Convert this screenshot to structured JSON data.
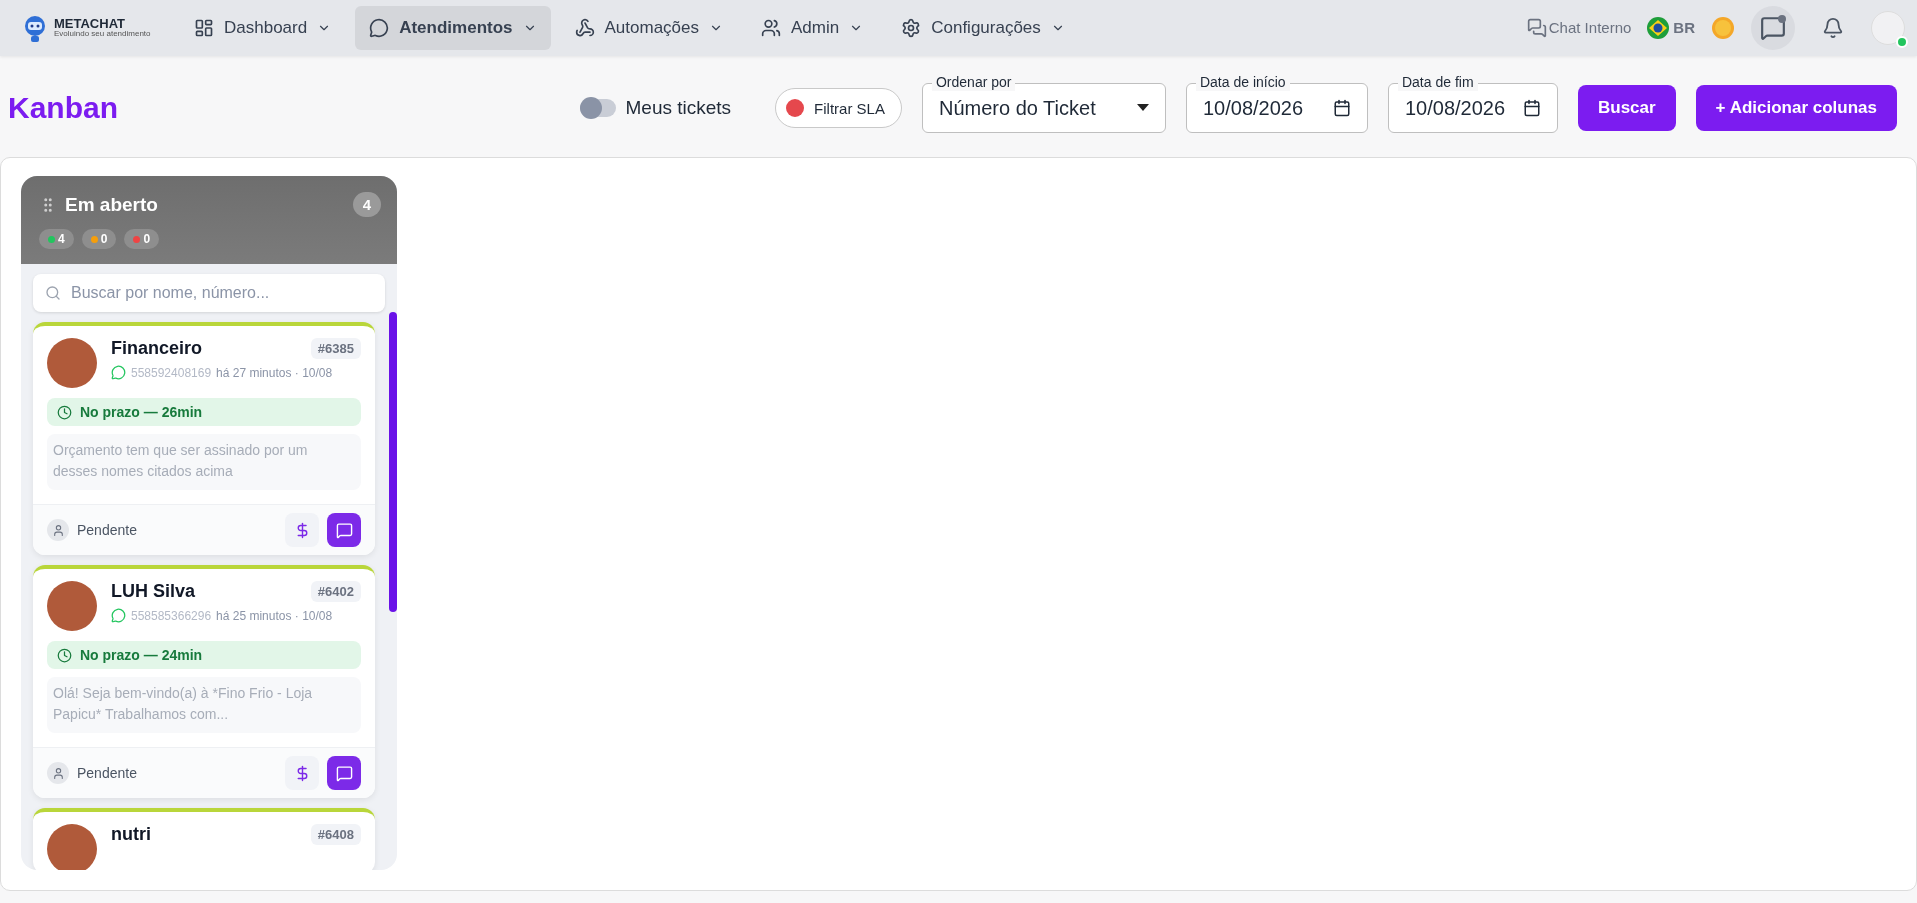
{
  "brand": {
    "name": "METACHAT",
    "tagline": "Evoluindo seu atendimento"
  },
  "nav": [
    {
      "label": "Dashboard",
      "selected": false
    },
    {
      "label": "Atendimentos",
      "selected": true
    },
    {
      "label": "Automações",
      "selected": false
    },
    {
      "label": "Admin",
      "selected": false
    },
    {
      "label": "Configurações",
      "selected": false
    }
  ],
  "topbar": {
    "chat_label": "Chat Interno",
    "language": "BR",
    "chat_unread": true,
    "online": true
  },
  "page_title": "Kanban",
  "filters": {
    "my_tickets": {
      "label": "Meus tickets",
      "on": false
    },
    "sla_button": "Filtrar SLA",
    "sort": {
      "label": "Ordenar por",
      "value": "Número do Ticket"
    },
    "start": {
      "label": "Data de início",
      "value": "10/08/2026"
    },
    "end": {
      "label": "Data de fim",
      "value": "10/08/2026"
    },
    "search_button": "Buscar",
    "add_button": "+ Adicionar colunas"
  },
  "columns": [
    {
      "title": "Em aberto",
      "count": "4",
      "sla_counts": [
        {
          "value": "4",
          "color": "#22c55e"
        },
        {
          "value": "0",
          "color": "#f59e0b"
        },
        {
          "value": "0",
          "color": "#ef4444"
        }
      ],
      "search_placeholder": "Buscar por nome, número...",
      "cards": [
        {
          "name": "Financeiro",
          "ticket": "#6385",
          "phone": "558592408169",
          "time": "há 27 minutos · 10/08",
          "sla": "No prazo — 26min",
          "message": "Orçamento tem que ser assinado por um desses nomes citados acima",
          "status": "Pendente"
        },
        {
          "name": "LUH Silva",
          "ticket": "#6402",
          "phone": "558585366296",
          "time": "há 25 minutos · 10/08",
          "sla": "No prazo — 24min",
          "message": "Olá! Seja bem-vindo(a) à *Fino Frio - Loja Papicu* Trabalhamos com...",
          "status": "Pendente"
        },
        {
          "name": "nutri",
          "ticket": "#6408"
        }
      ]
    }
  ]
}
